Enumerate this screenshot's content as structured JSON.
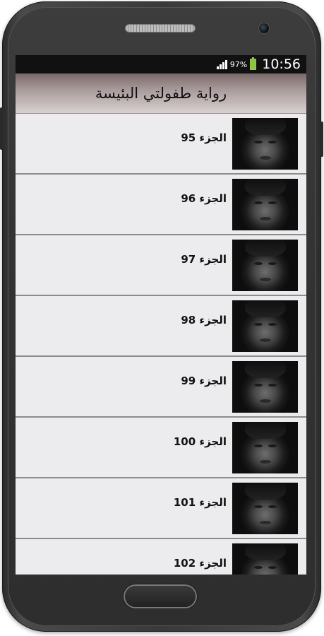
{
  "statusbar": {
    "battery_percent": "97%",
    "time": "10:56"
  },
  "header": {
    "title": "رواية طفولتي البئيسة"
  },
  "list": {
    "items": [
      {
        "label": "الجزء 95"
      },
      {
        "label": "الجزء 96"
      },
      {
        "label": "الجزء 97"
      },
      {
        "label": "الجزء 98"
      },
      {
        "label": "الجزء 99"
      },
      {
        "label": "الجزء 100"
      },
      {
        "label": "الجزء 101"
      },
      {
        "label": "الجزء 102"
      }
    ]
  },
  "colors": {
    "status_bar": "#111111",
    "battery": "#8bc34a",
    "list_background": "#ececee",
    "divider": "#8c8c8c"
  },
  "icons": [
    "signal-icon",
    "battery-icon",
    "thumbnail-image"
  ]
}
